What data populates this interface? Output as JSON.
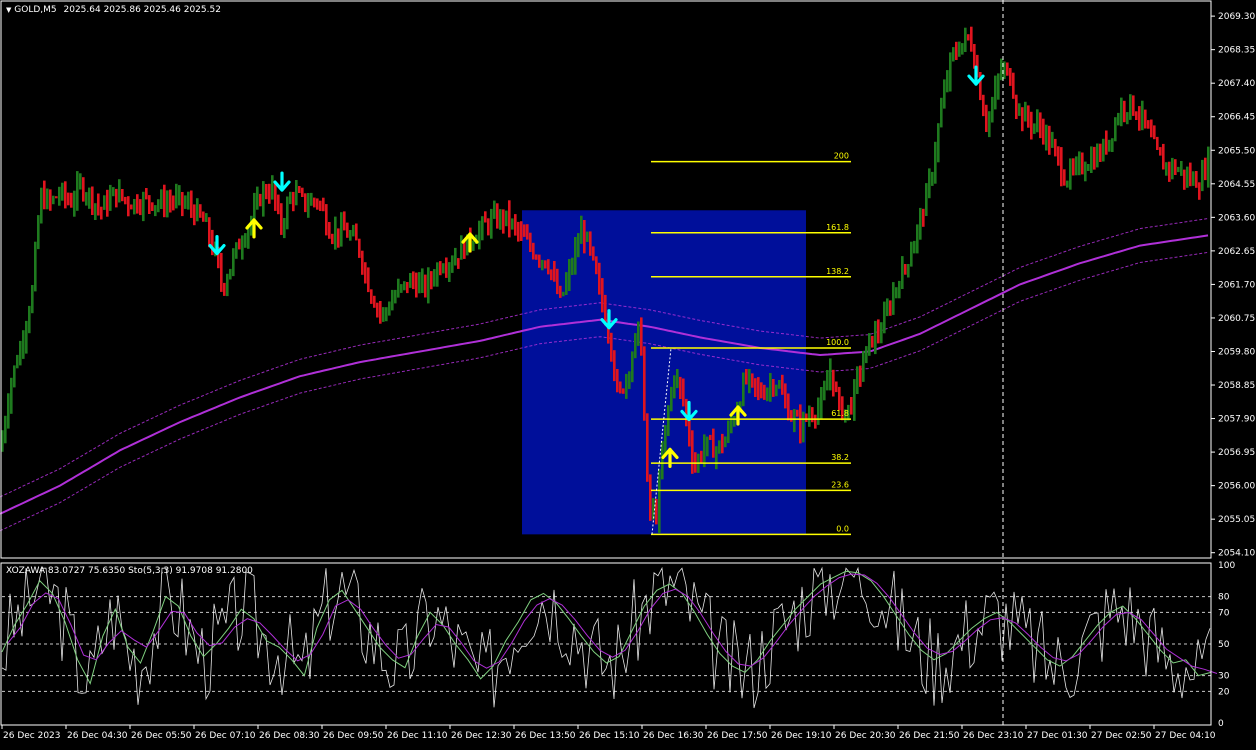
{
  "header": {
    "symbol": "GOLD,M5",
    "ohlc": "2025.64 2025.86 2025.46 2025.52"
  },
  "indicator_header": {
    "text": "XOZAWA 83.0727 75.6350  Sto(5,3,3) 91.9708 91.2800"
  },
  "colors": {
    "background": "#000000",
    "bull_bar": "#1e7a1e",
    "bear_bar": "#e0141e",
    "moving_average": "#b030d8",
    "fib_box": "#000f9a",
    "fib_lines": "#ffff00",
    "buy_arrow": "#ffff00",
    "sell_arrow": "#00ffff",
    "axis_text": "#ffffff",
    "oscillator_main": "#ffffff",
    "oscillator_signal": "#b030d8",
    "stochastic": "#7fcf7f"
  },
  "chart_data": [
    {
      "type": "candlestick",
      "title": "GOLD,M5",
      "y_axis_ticks": [
        "2069.30",
        "2068.35",
        "2067.40",
        "2066.45",
        "2065.50",
        "2064.55",
        "2063.60",
        "2062.65",
        "2061.70",
        "2060.75",
        "2059.80",
        "2058.85",
        "2057.90",
        "2056.95",
        "2056.00",
        "2055.05",
        "2054.10"
      ],
      "ylim": [
        2053.95,
        2069.7
      ],
      "x_axis_ticks": [
        "26 Dec 2023",
        "26 Dec 04:30",
        "26 Dec 05:50",
        "26 Dec 07:10",
        "26 Dec 08:30",
        "26 Dec 09:50",
        "26 Dec 11:10",
        "26 Dec 12:30",
        "26 Dec 13:50",
        "26 Dec 15:10",
        "26 Dec 16:30",
        "26 Dec 17:50",
        "26 Dec 19:10",
        "26 Dec 20:30",
        "26 Dec 21:50",
        "26 Dec 23:10",
        "27 Dec 01:30",
        "27 Dec 02:50",
        "27 Dec 04:10"
      ],
      "price_path": [
        [
          0,
          2057.0
        ],
        [
          10,
          2058.9
        ],
        [
          20,
          2059.9
        ],
        [
          32,
          2061.5
        ],
        [
          40,
          2064.2
        ],
        [
          50,
          2064.0
        ],
        [
          60,
          2064.3
        ],
        [
          70,
          2064.0
        ],
        [
          80,
          2064.5
        ],
        [
          90,
          2064.2
        ],
        [
          100,
          2063.8
        ],
        [
          115,
          2064.3
        ],
        [
          130,
          2064.0
        ],
        [
          145,
          2064.1
        ],
        [
          160,
          2064.0
        ],
        [
          175,
          2064.1
        ],
        [
          190,
          2063.9
        ],
        [
          205,
          2063.4
        ],
        [
          215,
          2062.5
        ],
        [
          222,
          2061.6
        ],
        [
          235,
          2062.6
        ],
        [
          250,
          2063.5
        ],
        [
          262,
          2064.3
        ],
        [
          272,
          2064.4
        ],
        [
          280,
          2063.3
        ],
        [
          292,
          2064.3
        ],
        [
          305,
          2064.0
        ],
        [
          318,
          2064.1
        ],
        [
          330,
          2063.2
        ],
        [
          345,
          2063.2
        ],
        [
          358,
          2062.8
        ],
        [
          370,
          2061.5
        ],
        [
          382,
          2060.8
        ],
        [
          395,
          2061.4
        ],
        [
          410,
          2061.8
        ],
        [
          425,
          2061.6
        ],
        [
          440,
          2062.3
        ],
        [
          452,
          2062.4
        ],
        [
          465,
          2062.8
        ],
        [
          478,
          2063.2
        ],
        [
          490,
          2063.5
        ],
        [
          505,
          2063.6
        ],
        [
          520,
          2063.1
        ],
        [
          535,
          2062.6
        ],
        [
          548,
          2062.3
        ],
        [
          560,
          2061.2
        ],
        [
          572,
          2062.3
        ],
        [
          582,
          2063.3
        ],
        [
          590,
          2062.6
        ],
        [
          600,
          2061.4
        ],
        [
          610,
          2060.2
        ],
        [
          618,
          2058.4
        ],
        [
          628,
          2059.3
        ],
        [
          640,
          2060.6
        ],
        [
          648,
          2055.3
        ],
        [
          656,
          2055.2
        ],
        [
          664,
          2057.4
        ],
        [
          674,
          2059.2
        ],
        [
          684,
          2058.3
        ],
        [
          694,
          2056.5
        ],
        [
          705,
          2057.2
        ],
        [
          715,
          2057.0
        ],
        [
          725,
          2057.3
        ],
        [
          735,
          2058.1
        ],
        [
          745,
          2059.0
        ],
        [
          760,
          2058.6
        ],
        [
          775,
          2059.0
        ],
        [
          790,
          2058.0
        ],
        [
          800,
          2057.7
        ],
        [
          812,
          2058.1
        ],
        [
          822,
          2058.3
        ],
        [
          830,
          2059.3
        ],
        [
          840,
          2058.1
        ],
        [
          850,
          2058.2
        ],
        [
          858,
          2059.1
        ],
        [
          870,
          2060.1
        ],
        [
          882,
          2060.5
        ],
        [
          895,
          2061.6
        ],
        [
          905,
          2062.2
        ],
        [
          918,
          2063.3
        ],
        [
          930,
          2064.6
        ],
        [
          940,
          2066.5
        ],
        [
          950,
          2068.0
        ],
        [
          960,
          2068.5
        ],
        [
          970,
          2068.7
        ],
        [
          978,
          2067.5
        ],
        [
          985,
          2066.3
        ],
        [
          992,
          2066.7
        ],
        [
          1000,
          2067.8
        ],
        [
          1010,
          2067.6
        ],
        [
          1018,
          2066.6
        ],
        [
          1030,
          2066.3
        ],
        [
          1042,
          2066.1
        ],
        [
          1055,
          2065.4
        ],
        [
          1065,
          2064.7
        ],
        [
          1075,
          2064.9
        ],
        [
          1088,
          2065.2
        ],
        [
          1100,
          2065.4
        ],
        [
          1110,
          2065.9
        ],
        [
          1120,
          2066.7
        ],
        [
          1130,
          2066.8
        ],
        [
          1142,
          2066.4
        ],
        [
          1152,
          2065.7
        ],
        [
          1162,
          2065.1
        ],
        [
          1175,
          2065.0
        ],
        [
          1188,
          2064.7
        ],
        [
          1200,
          2064.6
        ],
        [
          1211,
          2065.5
        ]
      ],
      "moving_average": {
        "series_name": "",
        "path": [
          [
            0,
            2055.2
          ],
          [
            60,
            2056.0
          ],
          [
            120,
            2057.0
          ],
          [
            180,
            2057.8
          ],
          [
            240,
            2058.5
          ],
          [
            300,
            2059.1
          ],
          [
            360,
            2059.5
          ],
          [
            420,
            2059.8
          ],
          [
            480,
            2060.1
          ],
          [
            540,
            2060.5
          ],
          [
            600,
            2060.7
          ],
          [
            650,
            2060.5
          ],
          [
            700,
            2060.2
          ],
          [
            760,
            2059.9
          ],
          [
            820,
            2059.7
          ],
          [
            870,
            2059.8
          ],
          [
            920,
            2060.3
          ],
          [
            970,
            2061.0
          ],
          [
            1020,
            2061.7
          ],
          [
            1080,
            2062.3
          ],
          [
            1140,
            2062.8
          ],
          [
            1211,
            2063.1
          ]
        ],
        "band_width": 0.48
      },
      "fibonacci": {
        "low": 2054.62,
        "high": 2059.9,
        "levels": [
          {
            "label": "200",
            "ratio": 2.0
          },
          {
            "label": "161.8",
            "ratio": 1.618
          },
          {
            "label": "138.2",
            "ratio": 1.382
          },
          {
            "label": "100.0",
            "ratio": 1.0
          },
          {
            "label": "61.8",
            "ratio": 0.618
          },
          {
            "label": "38.2",
            "ratio": 0.382
          },
          {
            "label": "23.6",
            "ratio": 0.236
          },
          {
            "label": "0.0",
            "ratio": 0.0
          }
        ],
        "box": {
          "x_start": 522,
          "x_end": 806,
          "y_top": 2063.8,
          "y_bottom": 2054.62
        }
      },
      "signals": [
        {
          "type": "sell",
          "bar": 217,
          "price": 2062.8
        },
        {
          "type": "buy",
          "bar": 254,
          "price": 2063.3
        },
        {
          "type": "sell",
          "bar": 282,
          "price": 2064.6
        },
        {
          "type": "buy",
          "bar": 470,
          "price": 2062.9
        },
        {
          "type": "sell",
          "bar": 609,
          "price": 2060.7
        },
        {
          "type": "sell",
          "bar": 689,
          "price": 2058.1
        },
        {
          "type": "buy",
          "bar": 670,
          "price": 2056.8
        },
        {
          "type": "buy",
          "bar": 738,
          "price": 2058.0
        },
        {
          "type": "sell",
          "bar": 976,
          "price": 2067.6
        }
      ],
      "vertical_marker_bar": 1003
    },
    {
      "type": "line",
      "title": "XOZAWA 83.0727 75.6350  Sto(5,3,3) 91.9708 91.2800",
      "y_axis_ticks": [
        "100",
        "80",
        "70",
        "50",
        "30",
        "20",
        "0"
      ],
      "ylim": [
        0,
        100
      ],
      "levels": [
        80,
        70,
        50,
        30,
        20
      ],
      "series": [
        {
          "name": "",
          "values": [
            45,
            62,
            75,
            90,
            82,
            64,
            40,
            25,
            55,
            72,
            48,
            38,
            58,
            80,
            74,
            55,
            42,
            50,
            60,
            72,
            66,
            52,
            48,
            40,
            30,
            60,
            78,
            84,
            72,
            60,
            48,
            40,
            35,
            55,
            70,
            62,
            50,
            40,
            28,
            36,
            52,
            64,
            78,
            82,
            76,
            66,
            55,
            45,
            38,
            42,
            58,
            74,
            84,
            88,
            82,
            70,
            56,
            44,
            36,
            32,
            40,
            52,
            62,
            72,
            80,
            88,
            92,
            96,
            95,
            90,
            80,
            68,
            56,
            46,
            40,
            44,
            52,
            60,
            66,
            70,
            64,
            56,
            48,
            40,
            36,
            42,
            52,
            62,
            70,
            74,
            66,
            56,
            46,
            38,
            40,
            30,
            32
          ]
        }
      ]
    }
  ]
}
